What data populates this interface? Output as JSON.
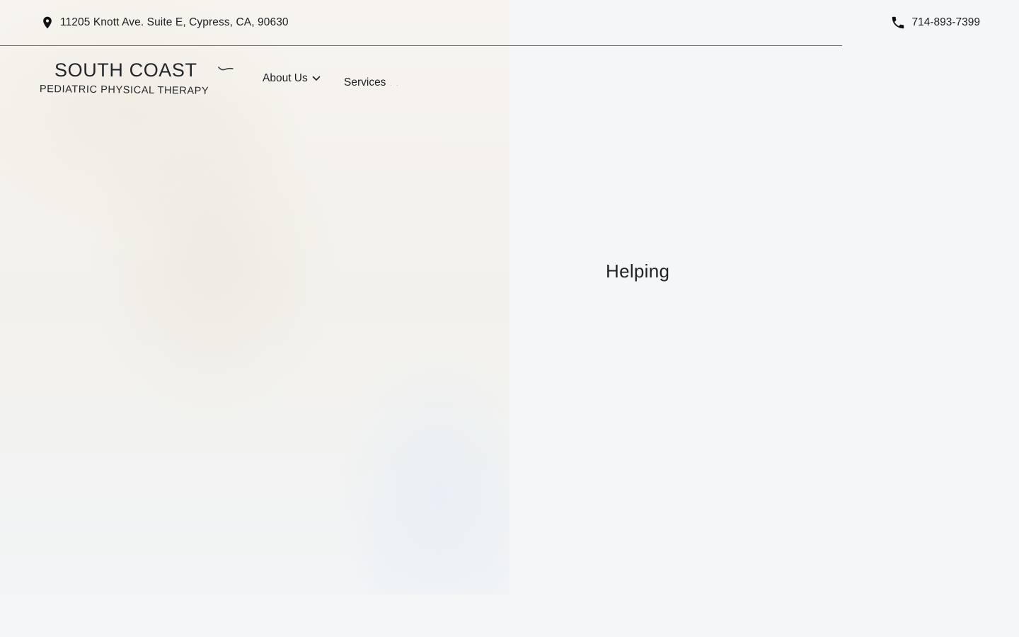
{
  "topbar": {
    "address": "11205 Knott Ave. Suite E, Cypress, CA, 90630",
    "phone": "714-893-7399",
    "address_icon": "map-pin-icon",
    "phone_icon": "phone-icon"
  },
  "logo": {
    "line1": "SOUTH COAST",
    "line2": "PEDIATRIC PHYSICAL THERAPY",
    "mark_icon": "bird-icon"
  },
  "nav": {
    "items": [
      {
        "label": "About Us",
        "icon": "chevron-down-icon"
      },
      {
        "label": "Services",
        "icon": "chevron-down-icon"
      }
    ]
  },
  "hero": {
    "text": "Helping"
  },
  "colors": {
    "background": "#f4f6f8",
    "text": "#1f2327",
    "rule": "#6c6c6c"
  }
}
